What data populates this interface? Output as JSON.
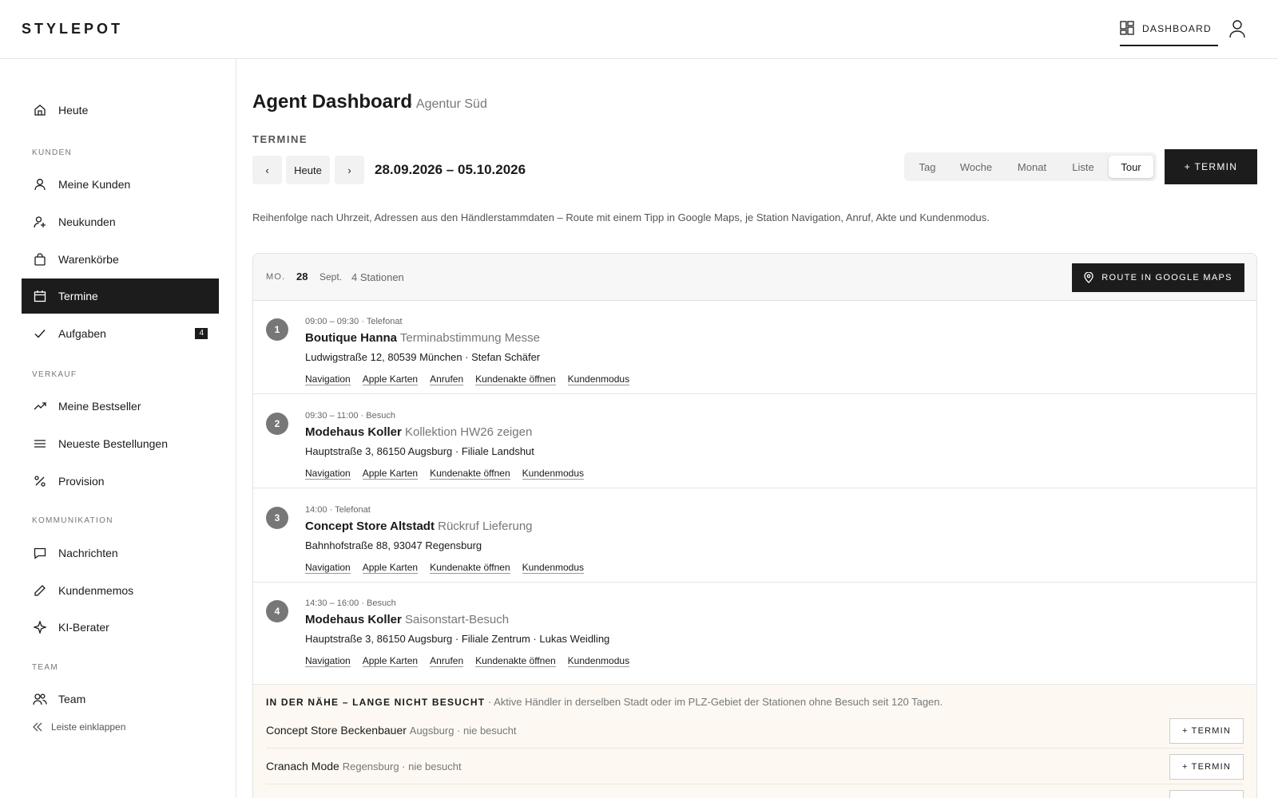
{
  "header": {
    "brand": "STYLEPOT",
    "dashboard_label": "DASHBOARD",
    "dashboard_icon": "dashboard-grid-icon",
    "user_icon": "user-icon"
  },
  "sidebar": {
    "items": [
      {
        "label": "Heute",
        "icon": "home-icon"
      },
      {
        "label": "Meine Kunden",
        "icon": "user-icon"
      },
      {
        "label": "Neukunden",
        "icon": "user-plus-icon"
      },
      {
        "label": "Warenkörbe",
        "icon": "shopping-bag-icon"
      },
      {
        "label": "Termine",
        "icon": "calendar-icon",
        "active": true
      },
      {
        "label": "Aufgaben",
        "icon": "check-icon",
        "badge": "4"
      },
      {
        "label": "Meine Bestseller",
        "icon": "trending-up-icon"
      },
      {
        "label": "Neueste Bestellungen",
        "icon": "list-icon"
      },
      {
        "label": "Provision",
        "icon": "percent-icon"
      },
      {
        "label": "Nachrichten",
        "icon": "message-icon"
      },
      {
        "label": "Kundenmemos",
        "icon": "pencil-icon"
      },
      {
        "label": "KI-Berater",
        "icon": "sparkle-icon"
      },
      {
        "label": "Team",
        "icon": "users-icon"
      }
    ],
    "sections": [
      "KUNDEN",
      "VERKAUF",
      "KOMMUNIKATION",
      "TEAM"
    ],
    "collapse_label": "Leiste einklappen"
  },
  "main": {
    "title": "Agent Dashboard",
    "subtitle": "· Agentur Süd",
    "section_label": "TERMINE",
    "prev_label": "‹",
    "today_label": "Heute",
    "next_label": "›",
    "date_range": "28.09.2026 – 05.10.2026",
    "views": [
      "Tag",
      "Woche",
      "Monat",
      "Liste",
      "Tour"
    ],
    "active_view": "Tour",
    "add_label": "+ TERMIN",
    "info": "Reihenfolge nach Uhrzeit, Adressen aus den Händlerstammdaten – Route mit einem Tipp in Google Maps, je Station Navigation, Anruf, Akte und Kundenmodus."
  },
  "day": {
    "weekday": "MO.",
    "day": "28",
    "month": "Sept.",
    "stations": "4 Stationen",
    "route_label": "ROUTE IN GOOGLE MAPS",
    "route_icon": "map-pin-icon"
  },
  "stops": [
    {
      "num": "1",
      "time": "09:00 – 09:30 · Telefonat",
      "name": "Boutique Hanna",
      "purpose": "Terminabstimmung Messe",
      "address": "Ludwigstraße 12, 80539 München · Stefan Schäfer",
      "links": [
        "Navigation",
        "Apple Karten",
        "Anrufen",
        "Kundenakte öffnen",
        "Kundenmodus"
      ]
    },
    {
      "num": "2",
      "time": "09:30 – 11:00 · Besuch",
      "name": "Modehaus Koller",
      "purpose": "Kollektion HW26 zeigen",
      "address": "Hauptstraße 3, 86150 Augsburg · Filiale Landshut",
      "links": [
        "Navigation",
        "Apple Karten",
        "Kundenakte öffnen",
        "Kundenmodus"
      ]
    },
    {
      "num": "3",
      "time": "14:00 · Telefonat",
      "name": "Concept Store Altstadt",
      "purpose": "Rückruf Lieferung",
      "address": "Bahnhofstraße 88, 93047 Regensburg",
      "links": [
        "Navigation",
        "Apple Karten",
        "Kundenakte öffnen",
        "Kundenmodus"
      ]
    },
    {
      "num": "4",
      "time": "14:30 – 16:00 · Besuch",
      "name": "Modehaus Koller",
      "purpose": "Saisonstart-Besuch",
      "address": "Hauptstraße 3, 86150 Augsburg · Filiale Zentrum · Lukas Weidling",
      "links": [
        "Navigation",
        "Apple Karten",
        "Anrufen",
        "Kundenakte öffnen",
        "Kundenmodus"
      ]
    }
  ],
  "nearby": {
    "title": "IN DER NÄHE – LANGE NICHT BESUCHT",
    "desc": "· Aktive Händler in derselben Stadt oder im PLZ-Gebiet der Stationen ohne Besuch seit 120 Tagen.",
    "rows": [
      {
        "name": "Concept Store Beckenbauer",
        "meta": "Augsburg · nie besucht",
        "button": "+ TERMIN"
      },
      {
        "name": "Cranach Mode",
        "meta": "Regensburg · nie besucht",
        "button": "+ TERMIN"
      }
    ]
  }
}
